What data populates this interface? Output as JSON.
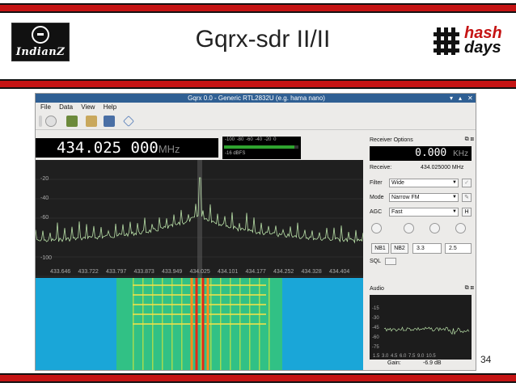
{
  "slide": {
    "title": "Gqrx-sdr II/II",
    "page_number": "34",
    "left_logo_text": "IndianZ",
    "right_logo_line1": "hash",
    "right_logo_line2": "days"
  },
  "window": {
    "title": "Gqrx 0.0 - Generic RTL2832U (e.g. hama nano)",
    "controls": [
      "▾",
      "▴",
      "✕"
    ],
    "menu": [
      "File",
      "Data",
      "View",
      "Help"
    ]
  },
  "main_frequency": {
    "digits": "434.025 000",
    "unit": "MHz"
  },
  "signal_meter": {
    "scale": [
      "-100",
      "-80",
      "-60",
      "-40",
      "-20",
      "0"
    ],
    "level_fraction": 0.95,
    "readout": "-16 dBFS"
  },
  "spectrum": {
    "y_labels": [
      "-20",
      "-40",
      "-60",
      "-100"
    ],
    "x_ticks": [
      "433.646",
      "433.722",
      "433.797",
      "433.873",
      "433.949",
      "434.025",
      "434.101",
      "434.177",
      "434.252",
      "434.328",
      "434.404"
    ]
  },
  "receiver_options": {
    "header": "Receiver Options",
    "frequency": "0.000",
    "frequency_unit": "KHz",
    "receive_label": "Receive:",
    "receive_value": "434.025000 MHz",
    "filter_label": "Filter",
    "filter_value": "Wide",
    "mode_label": "Mode",
    "mode_value": "Narrow FM",
    "agc_label": "AGC",
    "agc_value": "Fast",
    "agc_h_button": "H",
    "nb1_label": "NB1",
    "nb2_label": "NB2",
    "nb1_threshold": "3.3",
    "nb2_threshold": "2.5",
    "sql_label": "SQL"
  },
  "audio": {
    "header": "Audio",
    "y_labels": [
      "-15",
      "-30",
      "-45",
      "-60",
      "-75"
    ],
    "x_labels": "1.5 3.0 4.5 6.0 7.5 9.0 10.5",
    "gain_label": "Gain:",
    "gain_value": "-6.9 dB"
  }
}
